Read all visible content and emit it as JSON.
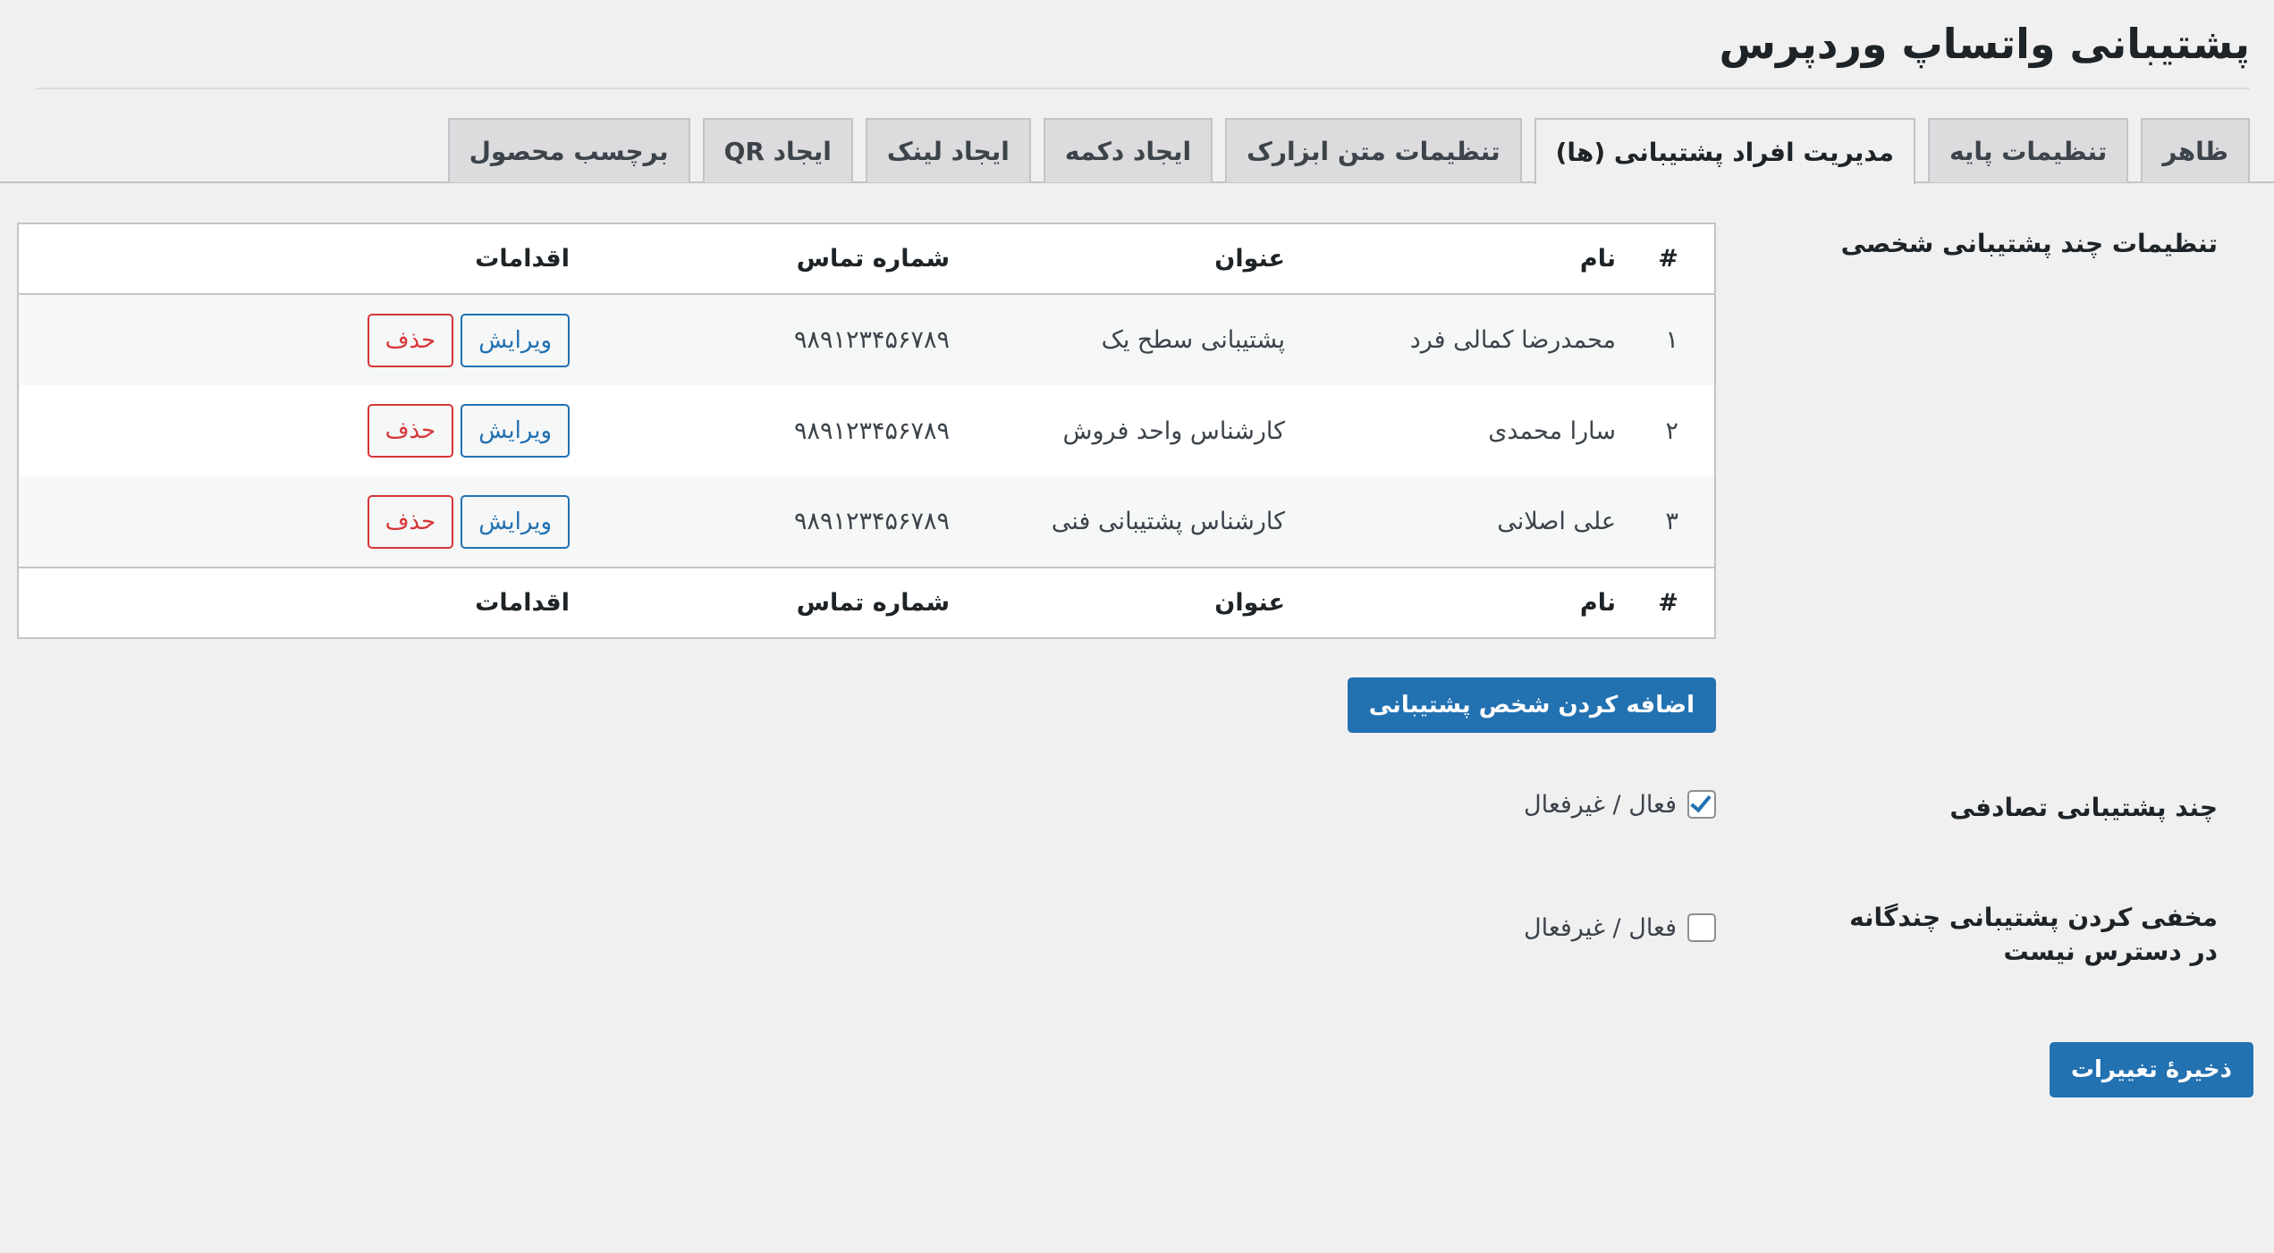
{
  "page": {
    "title": "پشتیبانی واتساپ وردپرس"
  },
  "tabs": [
    {
      "label": "ظاهر",
      "active": false
    },
    {
      "label": "تنظیمات پایه",
      "active": false
    },
    {
      "label": "مدیریت افراد پشتیبانی (ها)",
      "active": true
    },
    {
      "label": "تنظیمات متن ابزارک",
      "active": false
    },
    {
      "label": "ایجاد دکمه",
      "active": false
    },
    {
      "label": "ایجاد لینک",
      "active": false
    },
    {
      "label": "ایجاد QR",
      "active": false
    },
    {
      "label": "برچسب محصول",
      "active": false
    }
  ],
  "support_section": {
    "label": "تنظیمات چند پشتیبانی شخصی",
    "columns": {
      "num": "#",
      "name": "نام",
      "title": "عنوان",
      "phone": "شماره تماس",
      "actions": "اقدامات"
    },
    "rows": [
      {
        "num": "۱",
        "name": "محمدرضا کمالی فرد",
        "title": "پشتیبانی سطح یک",
        "phone": "۹۸۹۱۲۳۴۵۶۷۸۹"
      },
      {
        "num": "۲",
        "name": "سارا محمدی",
        "title": "کارشناس واحد فروش",
        "phone": "۹۸۹۱۲۳۴۵۶۷۸۹"
      },
      {
        "num": "۳",
        "name": "علی اصلانی",
        "title": "کارشناس پشتیبانی فنی",
        "phone": "۹۸۹۱۲۳۴۵۶۷۸۹"
      }
    ],
    "edit_label": "ویرایش",
    "delete_label": "حذف",
    "add_button": "اضافه کردن شخص پشتیبانی"
  },
  "random_support": {
    "label": "چند پشتیبانی تصادفی",
    "option": "فعال / غیرفعال",
    "checked": true
  },
  "hide_unavailable": {
    "label": "مخفی کردن پشتیبانی چندگانه در دسترس نیست",
    "option": "فعال / غیرفعال",
    "checked": false
  },
  "save_button": "ذخیرهٔ تغییرات",
  "colors": {
    "primary": "#2271b1",
    "danger": "#d63638",
    "background": "#f0f0f1"
  }
}
